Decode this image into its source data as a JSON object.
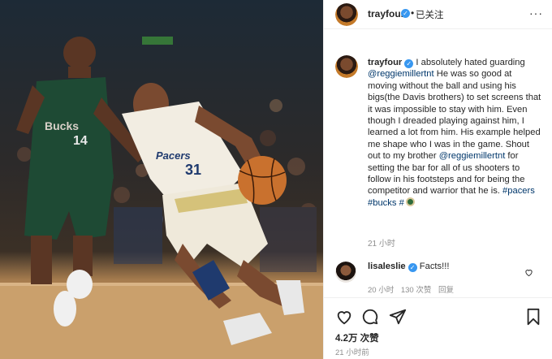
{
  "post": {
    "author": "trayfour",
    "follow_status": "已关注",
    "dot": "•",
    "more": "···",
    "caption_user": "trayfour",
    "caption_text": "I absolutely hated guarding",
    "mention1": "@reggiemillertnt",
    "caption_text2": "He was so good at moving without the ball and using his bigs(the Davis brothers) to set screens that it was impossible to stay with him. Even though I dreaded playing against him, I learned a lot from him. His example helped me shape who I was in the game. Shout out to my brother",
    "mention2": "@reggiemillertnt",
    "caption_text3": "for setting the bar for all of us shooters to follow in his footsteps and for being the competitor and warrior that he is.",
    "hashtag1": "#pacers",
    "hashtag2": "#bucks",
    "hashtag3": "#",
    "time_ago": "21 小时",
    "likes": "4.2万 次赞",
    "post_time": "21 小时前"
  },
  "comment": {
    "user": "lisaleslie",
    "text": "Facts!!!",
    "time": "20 小时",
    "likes": "130 次赞",
    "reply": "回复"
  },
  "photo": {
    "jersey_green_number": "14",
    "jersey_green_text": "Bucks",
    "jersey_white_text": "Pacers",
    "jersey_white_number": "31"
  },
  "icons": [
    "heart-icon",
    "comment-icon",
    "share-icon",
    "bookmark-icon",
    "verified-badge-icon",
    "more-options-icon"
  ],
  "colors": {
    "accent": "#3897f0",
    "link": "#00376b",
    "muted": "#8e8e8e",
    "text": "#262626"
  }
}
